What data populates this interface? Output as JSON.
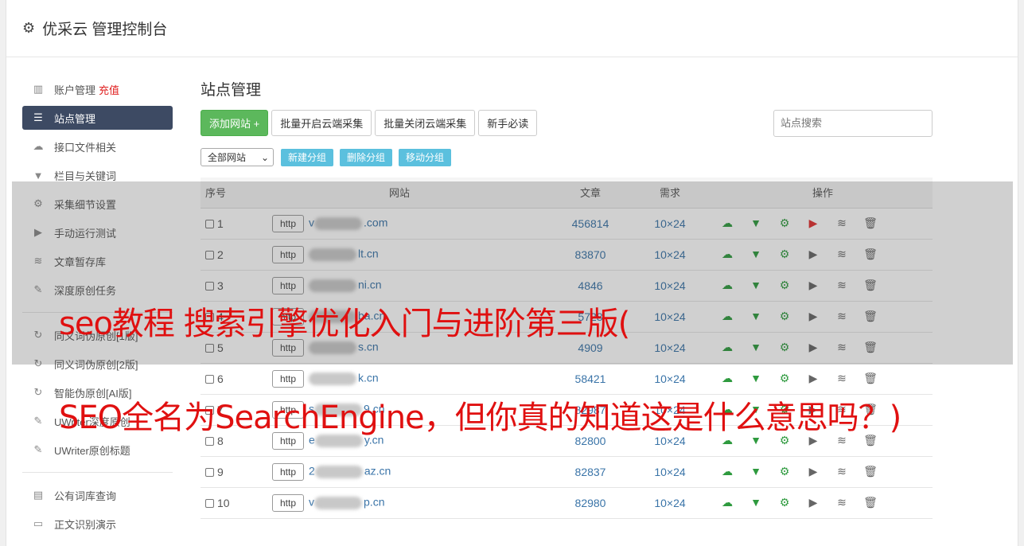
{
  "header": {
    "title": "优采云 管理控制台"
  },
  "sidebar": {
    "items": [
      {
        "icon": "bar-chart-icon",
        "glyph": "▥",
        "label": "账户管理",
        "badge": "充值"
      },
      {
        "icon": "server-icon",
        "glyph": "☰",
        "label": "站点管理",
        "active": true
      },
      {
        "icon": "cloud-upload-icon",
        "glyph": "☁",
        "label": "接口文件相关"
      },
      {
        "icon": "filter-icon",
        "glyph": "▼",
        "label": "栏目与关键词"
      },
      {
        "icon": "cogs-icon",
        "glyph": "⚙",
        "label": "采集细节设置"
      },
      {
        "icon": "play-circle-icon",
        "glyph": "▶",
        "label": "手动运行测试"
      },
      {
        "icon": "database-icon",
        "glyph": "≋",
        "label": "文章暂存库"
      },
      {
        "icon": "edit-icon",
        "glyph": "✎",
        "label": "深度原创任务"
      },
      {
        "icon": "refresh-icon",
        "glyph": "↻",
        "label": "同义词伪原创[1版]"
      },
      {
        "icon": "refresh-icon",
        "glyph": "↻",
        "label": "同义词伪原创[2版]"
      },
      {
        "icon": "refresh-icon",
        "glyph": "↻",
        "label": "智能伪原创[AI版]"
      },
      {
        "icon": "edit-icon",
        "glyph": "✎",
        "label": "UWriter深度原创"
      },
      {
        "icon": "edit-icon",
        "glyph": "✎",
        "label": "UWriter原创标题"
      },
      {
        "icon": "book-icon",
        "glyph": "▤",
        "label": "公有词库查询"
      },
      {
        "icon": "monitor-icon",
        "glyph": "▭",
        "label": "正文识别演示"
      }
    ]
  },
  "main": {
    "title": "站点管理",
    "buttons": {
      "add": "添加网站 +",
      "batch_open": "批量开启云端采集",
      "batch_close": "批量关闭云端采集",
      "guide": "新手必读"
    },
    "search_placeholder": "站点搜索",
    "group_select": "全部网站",
    "group_buttons": {
      "new": "新建分组",
      "delete": "删除分组",
      "move": "移动分组"
    },
    "table": {
      "headers": {
        "seq": "序号",
        "site": "网站",
        "articles": "文章",
        "demand": "需求",
        "ops": "操作"
      },
      "protocol": "http",
      "rows": [
        {
          "seq": "1",
          "site_prefix": "v",
          "site_suffix": ".com",
          "articles": "456814",
          "demand": "10×24",
          "play_red": true
        },
        {
          "seq": "2",
          "site_prefix": "",
          "site_suffix": "lt.cn",
          "articles": "83870",
          "demand": "10×24"
        },
        {
          "seq": "3",
          "site_prefix": "",
          "site_suffix": "ni.cn",
          "articles": "4846",
          "demand": "10×24"
        },
        {
          "seq": "4",
          "site_prefix": "",
          "site_suffix": "ba.cn",
          "articles": "5728",
          "demand": "10×24"
        },
        {
          "seq": "5",
          "site_prefix": "",
          "site_suffix": "s.cn",
          "articles": "4909",
          "demand": "10×24"
        },
        {
          "seq": "6",
          "site_prefix": "",
          "site_suffix": "k.cn",
          "articles": "58421",
          "demand": "10×24"
        },
        {
          "seq": "7",
          "site_prefix": "s",
          "site_suffix": "9.cn",
          "articles": "82987",
          "demand": "10×24"
        },
        {
          "seq": "8",
          "site_prefix": "e",
          "site_suffix": "y.cn",
          "articles": "82800",
          "demand": "10×24"
        },
        {
          "seq": "9",
          "site_prefix": "2",
          "site_suffix": "az.cn",
          "articles": "82837",
          "demand": "10×24"
        },
        {
          "seq": "10",
          "site_prefix": "v",
          "site_suffix": "p.cn",
          "articles": "82980",
          "demand": "10×24"
        }
      ]
    }
  },
  "overlay": {
    "caption_line1": "seo教程 搜索引擎优化入门与进阶第三版(",
    "caption_line2": "SEO全名为SearchEngine，但你真的知道这是什么意思吗？)"
  },
  "colors": {
    "sidebar_active": "#3d4a63",
    "add_button": "#5cb85c",
    "group_button": "#5bc0de",
    "caption": "#e01010"
  }
}
